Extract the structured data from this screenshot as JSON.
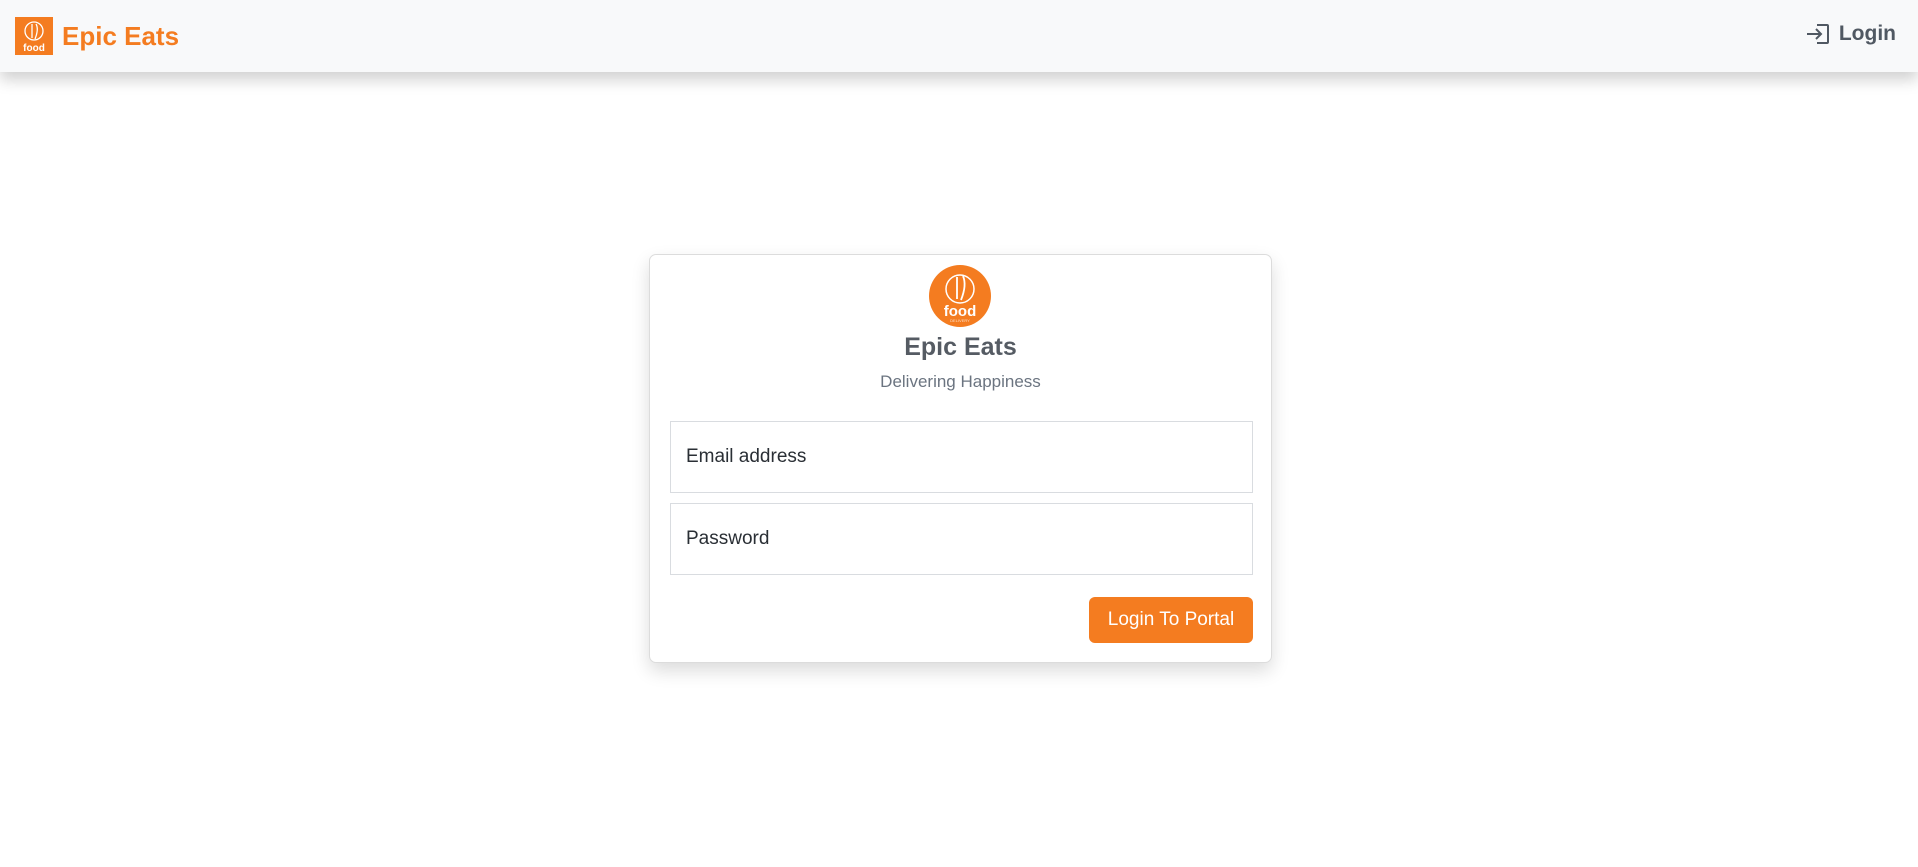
{
  "navbar": {
    "brand_name": "Epic Eats",
    "brand_logo_text": "food",
    "login_label": "Login",
    "login_icon": "box-arrow-in-right-icon"
  },
  "login_card": {
    "logo_text": "food",
    "logo_subtext": "DELIVERY",
    "title": "Epic Eats",
    "subtitle": "Delivering Happiness",
    "email_placeholder": "Email address",
    "password_placeholder": "Password",
    "submit_label": "Login To Portal"
  },
  "colors": {
    "brand": "#f47c20",
    "navbar_bg": "#f8f9fa",
    "text_muted": "#6b7480"
  }
}
